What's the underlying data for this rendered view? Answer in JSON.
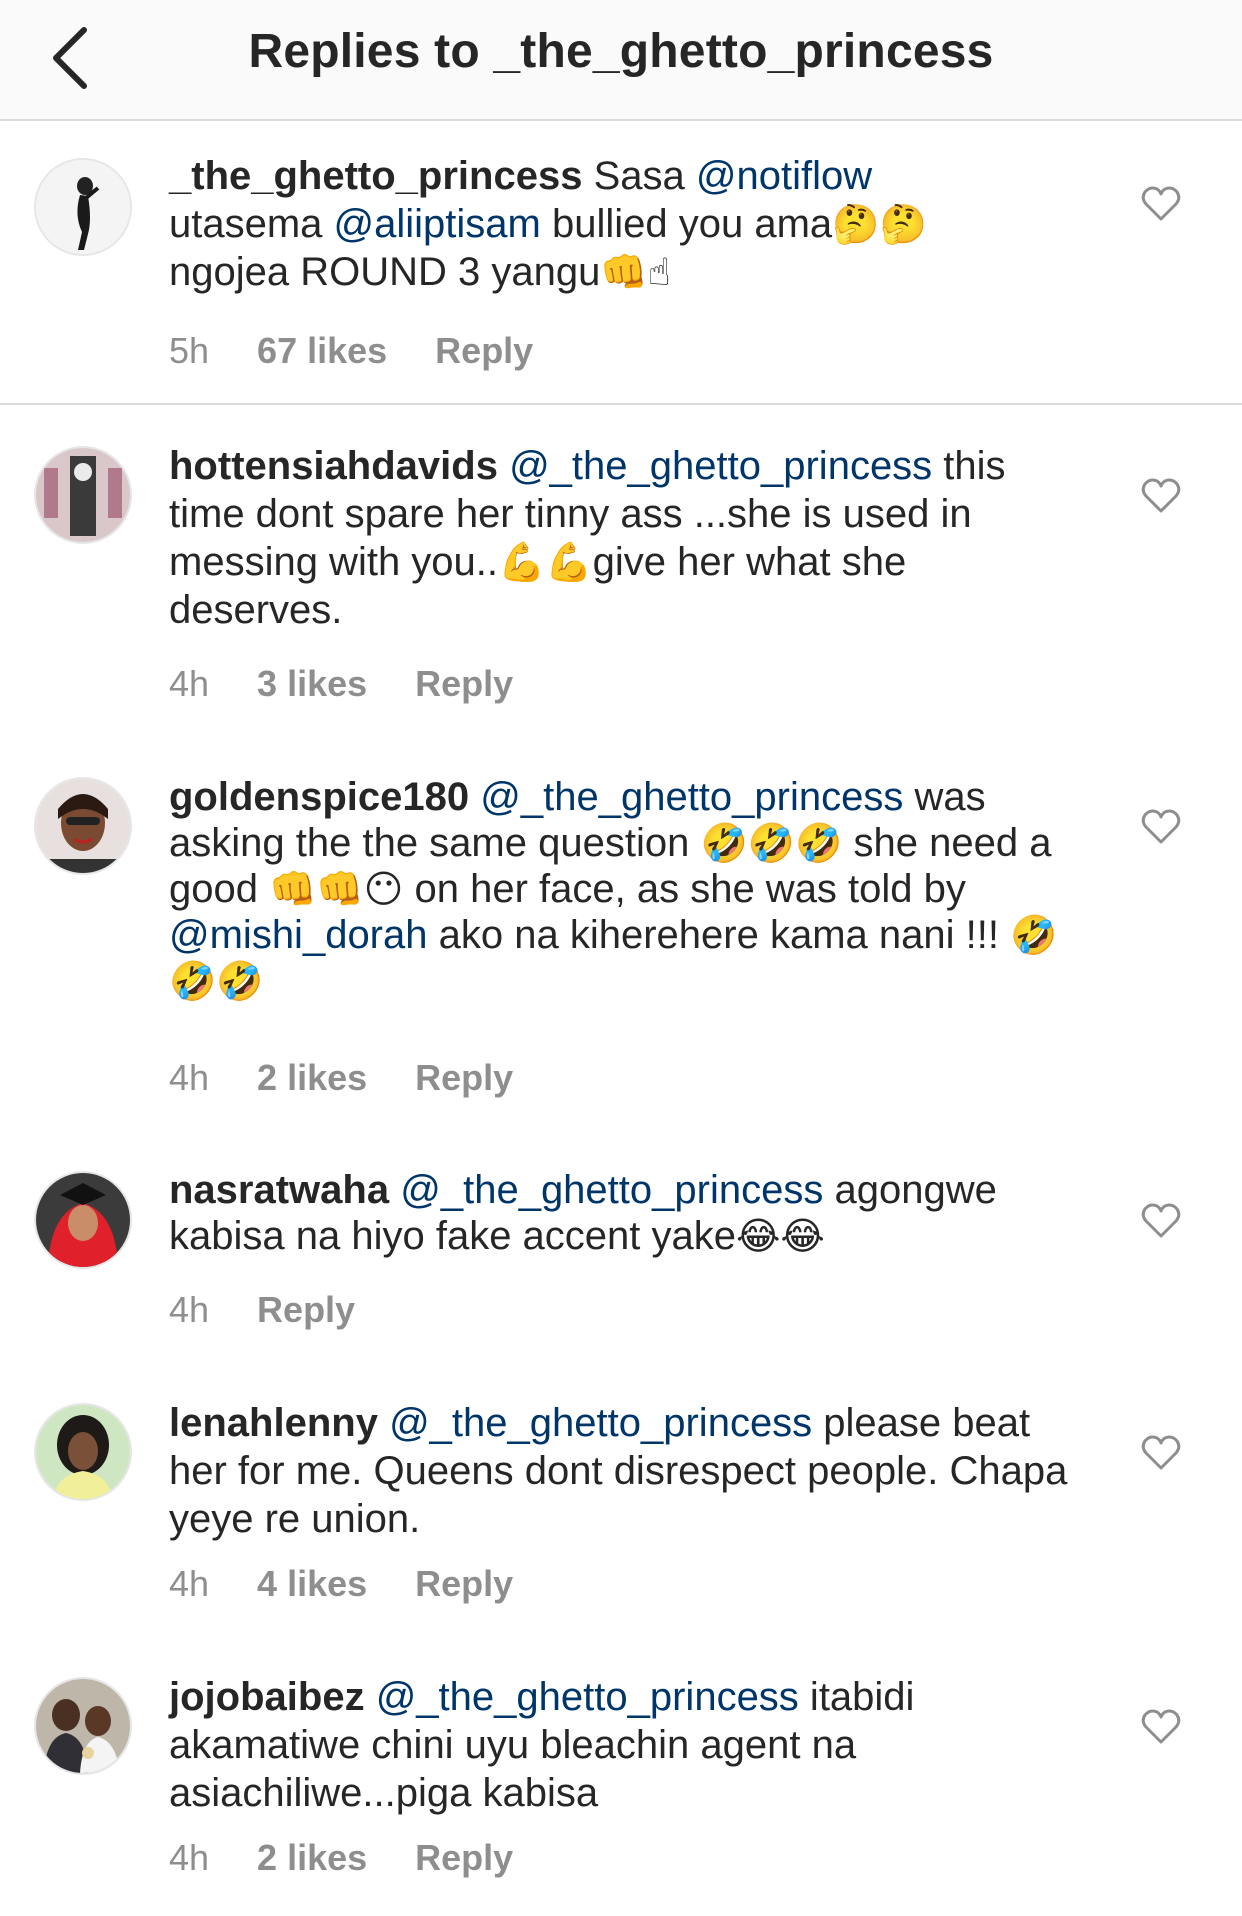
{
  "header": {
    "title": "Replies to _the_ghetto_princess"
  },
  "comments": [
    {
      "username": "_the_ghetto_princess",
      "t1": " Sasa ",
      "m1": "@notiflow",
      "t2": " utasema ",
      "m2": "@aliiptisam",
      "t3": " bullied you ama",
      "e1": "🤔🤔",
      "t4": " ngojea ROUND 3 yangu",
      "e2": "👊☝",
      "time": "5h",
      "likes": "67 likes",
      "reply": "Reply"
    },
    {
      "username": "hottensiahdavids",
      "t1": " ",
      "m1": "@_the_ghetto_princess",
      "t2": " this time dont spare her tinny ass ...she is used in messing with you..",
      "e1": "💪💪",
      "t3": "give her what she deserves.",
      "time": "4h",
      "likes": "3 likes",
      "reply": "Reply"
    },
    {
      "username": "goldenspice180",
      "t1": " ",
      "m1": "@_the_ghetto_princess",
      "t2": " was asking the the same question ",
      "e1": "🤣🤣🤣",
      "t3": "she need a good ",
      "e2": "👊👊😶",
      "t4": " on her face, as she was told by ",
      "m2": "@mishi_dorah",
      "t5": " ako na kiherehere kama nani !!! ",
      "e3": "🤣🤣🤣",
      "time": "4h",
      "likes": "2 likes",
      "reply": "Reply"
    },
    {
      "username": "nasratwaha",
      "t1": " ",
      "m1": "@_the_ghetto_princess",
      "t2": " agongwe kabisa na hiyo fake accent yake",
      "e1": "😂😂",
      "time": "4h",
      "reply": "Reply"
    },
    {
      "username": "lenahlenny",
      "t1": " ",
      "m1": "@_the_ghetto_princess",
      "t2": " please beat her for me. Queens dont disrespect people. Chapa yeye re union.",
      "time": "4h",
      "likes": "4 likes",
      "reply": "Reply"
    },
    {
      "username": "jojobaibez",
      "t1": " ",
      "m1": "@_the_ghetto_princess",
      "t2": " itabidi akamatiwe chini uyu bleachin agent na asiachiliwe...piga kabisa",
      "time": "4h",
      "likes": "2 likes",
      "reply": "Reply"
    }
  ]
}
